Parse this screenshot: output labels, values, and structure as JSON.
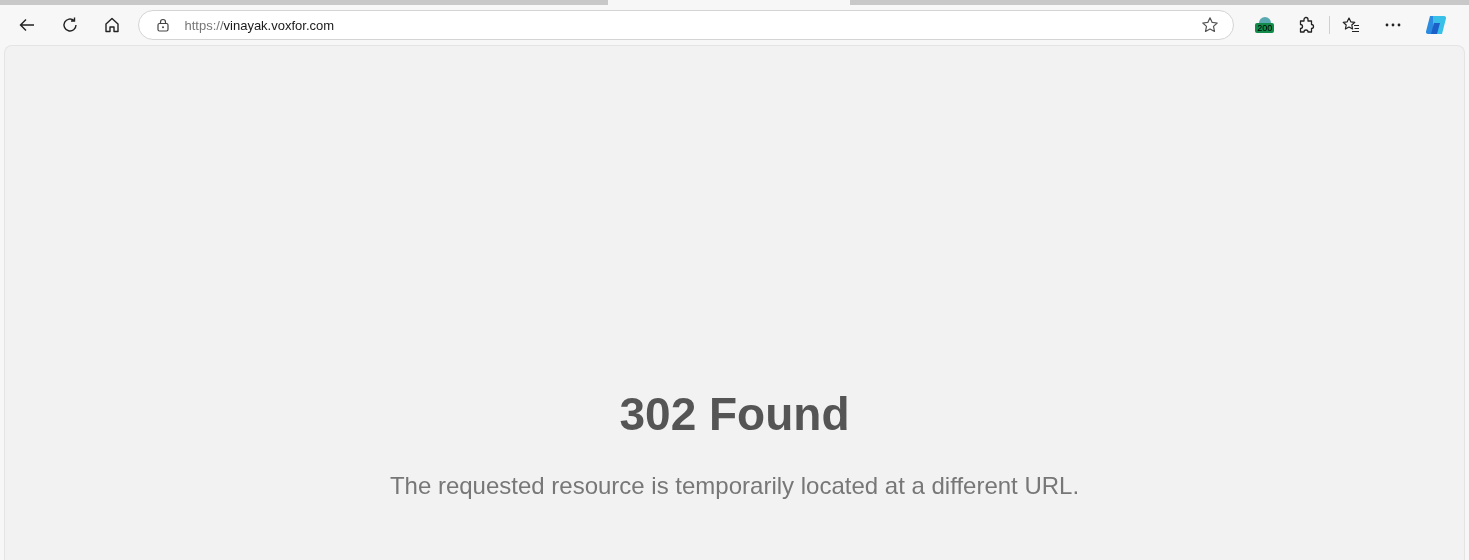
{
  "address_bar": {
    "scheme": "https://",
    "host": "vinayak.voxfor.com"
  },
  "extension_badge": "200",
  "page": {
    "heading": "302 Found",
    "message": "The requested resource is temporarily located at a different URL."
  }
}
